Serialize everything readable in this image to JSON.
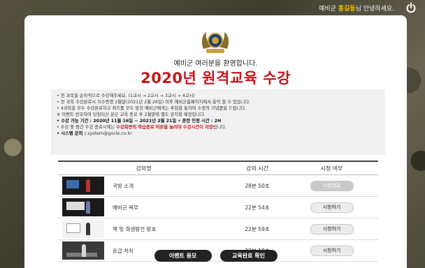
{
  "header": {
    "greeting_prefix": "예비군 ",
    "user_name": "홍길동",
    "greeting_suffix": "님 안녕하세요."
  },
  "intro": {
    "welcome": "예비군 여러분을 환영합니다.",
    "title": "2020년 원격교육 수강"
  },
  "notice": [
    "• 전 과목을 순차적으로 수강해주세요. (1교시 → 2교시 → 3교시 → 4교시)",
    "• 전 과목 수강완료시 이수증명 2월말(2021년 2월 26일) 이후 예비군홈페이지에서 출력 할 수 있습니다.",
    "• 4과목을 모두 수강완료하고 퀴즈를 모두 맞힌 예비군에게는 추첨을 통하여 소정의 기념품을 드립니다.",
    "   ※ 이벤트 응모하여 당첨되신 분은 교육 종료 후 2월말에 별도 공지할 예정입니다.",
    "• 수강 가능 기간 : 2020년 11월 16일 ~ 2021년 2월 21일   • 훈련 인정 시간 : 2H",
    "• 수강 중 중간 수강 종료시에는 ",
    "수강화면의 학습종료 버튼을 눌러야 수강시간이 저장",
    "됩니다.",
    "• 시스템 문의 : ",
    "system@gocle.co.kr"
  ],
  "table": {
    "headers": [
      "강의명",
      "강의 시간",
      "시청 여부"
    ],
    "rows": [
      {
        "name": "국방 소개",
        "time": "28분 50초",
        "status": "시청완료"
      },
      {
        "name": "예비군 복무",
        "time": "22분 54초",
        "status": "시청하기"
      },
      {
        "name": "핵 및 화생방전 방호",
        "time": "22분 59초",
        "status": "시청하기"
      },
      {
        "name": "응급 처치",
        "time": "22분 18초",
        "status": "시청하기"
      }
    ]
  },
  "buttons": {
    "event": "이벤트 응모",
    "complete": "교육완료 확인"
  },
  "icons": {
    "power": "power-icon",
    "emblem": "army-emblem-icon"
  },
  "colors": {
    "accent_red": "#c0181e",
    "highlight_yellow": "#f0c000",
    "button_dark": "#222222"
  }
}
